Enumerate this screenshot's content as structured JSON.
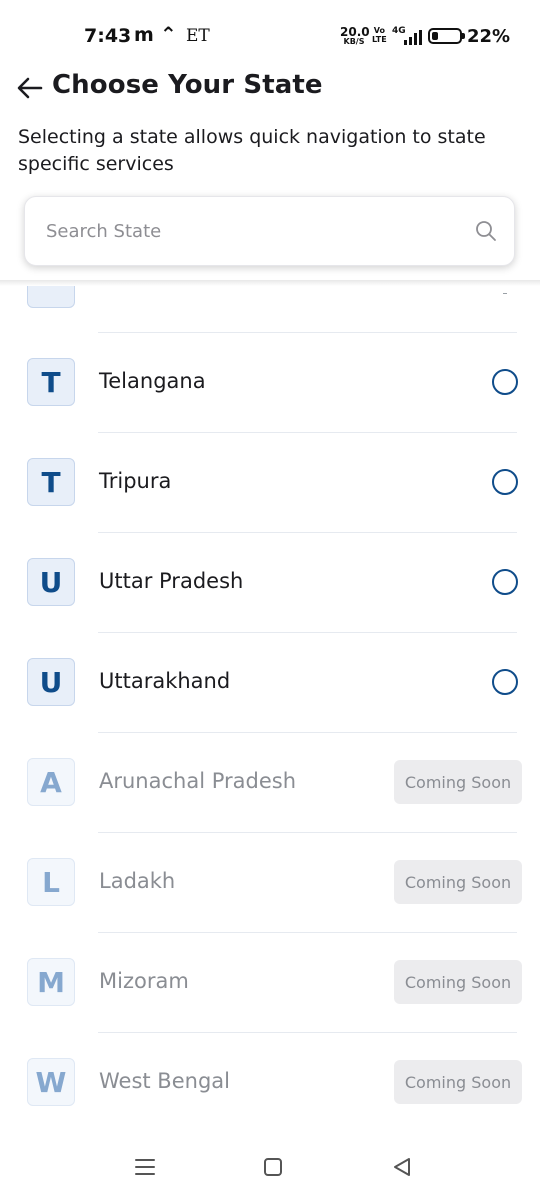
{
  "status_bar": {
    "time": "7:43",
    "app_glyph": "m",
    "up_glyph": "⌃",
    "et_text": "ET",
    "speed_value": "20.0",
    "speed_unit": "KB/S",
    "volte_top": "Vo",
    "volte_bottom": "LTE",
    "network": "4G",
    "battery_percent": 22,
    "battery_text": "22%",
    "icons": [
      "signal-icon",
      "battery-icon"
    ]
  },
  "header": {
    "back_icon": "arrow-left-icon",
    "title": "Choose Your State",
    "subtitle": "Selecting a state allows quick navigation to state specific services"
  },
  "search": {
    "placeholder": "Search State",
    "value": "",
    "icon": "search-icon"
  },
  "states": [
    {
      "initial": "T",
      "name": "Telangana",
      "status": "available"
    },
    {
      "initial": "T",
      "name": "Tripura",
      "status": "available"
    },
    {
      "initial": "U",
      "name": "Uttar Pradesh",
      "status": "available"
    },
    {
      "initial": "U",
      "name": "Uttarakhand",
      "status": "available"
    },
    {
      "initial": "A",
      "name": "Arunachal Pradesh",
      "status": "coming_soon",
      "chip": "Coming Soon"
    },
    {
      "initial": "L",
      "name": "Ladakh",
      "status": "coming_soon",
      "chip": "Coming Soon"
    },
    {
      "initial": "M",
      "name": "Mizoram",
      "status": "coming_soon",
      "chip": "Coming Soon"
    },
    {
      "initial": "W",
      "name": "West Bengal",
      "status": "coming_soon",
      "chip": "Coming Soon"
    }
  ],
  "nav_bar": {
    "buttons": [
      "menu-icon",
      "home-icon",
      "back-triangle-icon"
    ]
  },
  "colors": {
    "accent": "#0f4c8a",
    "badge_bg": "#e8eff9",
    "chip_bg": "#ececee",
    "muted_text": "#8a8d93"
  }
}
